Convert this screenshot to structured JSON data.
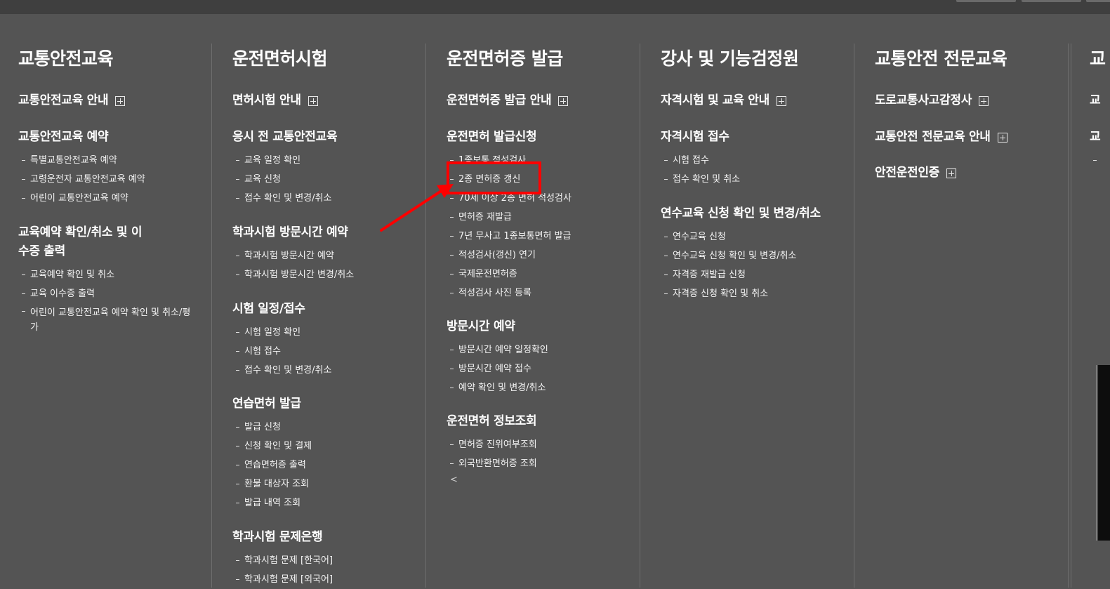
{
  "columns": [
    {
      "title": "교통안전교육",
      "sections": [
        {
          "label": "교통안전교육 안내",
          "expandable": true,
          "items": []
        },
        {
          "label": "교통안전교육 예약",
          "expandable": false,
          "items": [
            "특별교통안전교육 예약",
            "고령운전자 교통안전교육 예약",
            "어린이 교통안전교육 예약"
          ]
        },
        {
          "label": "교육예약 확인/취소 및 이수증 출력",
          "expandable": false,
          "items": [
            "교육예약 확인 및 취소",
            "교육 이수증 출력",
            "어린이 교통안전교육 예약 확인 및 취소/평가"
          ]
        }
      ]
    },
    {
      "title": "운전면허시험",
      "sections": [
        {
          "label": "면허시험 안내",
          "expandable": true,
          "items": []
        },
        {
          "label": "응시 전 교통안전교육",
          "expandable": false,
          "items": [
            "교육 일정 확인",
            "교육 신청",
            "접수 확인 및 변경/취소"
          ]
        },
        {
          "label": "학과시험 방문시간 예약",
          "expandable": false,
          "items": [
            "학과시험 방문시간 예약",
            "학과시험 방문시간 변경/취소"
          ]
        },
        {
          "label": "시험 일정/접수",
          "expandable": false,
          "items": [
            "시험 일정 확인",
            "시험 접수",
            "접수 확인 및 변경/취소"
          ]
        },
        {
          "label": "연습면허 발급",
          "expandable": false,
          "items": [
            "발급 신청",
            "신청 확인 및 결제",
            "연습면허증 출력",
            "환불 대상자 조회",
            "발급 내역 조회"
          ]
        },
        {
          "label": "학과시험 문제은행",
          "expandable": false,
          "items": [
            "학과시험 문제 [한국어]",
            "학과시험 문제 [외국어]"
          ]
        }
      ]
    },
    {
      "title": "운전면허증 발급",
      "sections": [
        {
          "label": "운전면허증 발급 안내",
          "expandable": true,
          "items": []
        },
        {
          "label": "운전면허 발급신청",
          "expandable": false,
          "items": [
            "1종보통 적성검사",
            "2종 면허증 갱신",
            "70세 이상 2종 면허 적성검사",
            "면허증 재발급",
            "7년 무사고 1종보통면허 발급",
            "적성검사(갱신) 연기",
            "국제운전면허증",
            "적성검사 사진 등록"
          ]
        },
        {
          "label": "방문시간 예약",
          "expandable": false,
          "items": [
            "방문시간 예약 일정확인",
            "방문시간 예약 접수",
            "예약 확인 및 변경/취소"
          ]
        },
        {
          "label": "운전면허 정보조회",
          "expandable": false,
          "items": [
            "면허증 진위여부조회",
            "외국반환면허증 조회"
          ]
        }
      ],
      "trailing_glyph": "<"
    },
    {
      "title": "강사 및 기능검정원",
      "sections": [
        {
          "label": "자격시험 및 교육 안내",
          "expandable": true,
          "items": []
        },
        {
          "label": "자격시험 접수",
          "expandable": false,
          "items": [
            "시험 접수",
            "접수 확인 및 취소"
          ]
        },
        {
          "label": "연수교육 신청 확인 및 변경/취소",
          "expandable": false,
          "items": [
            "연수교육 신청",
            "연수교육 신청 확인 및 변경/취소",
            "자격증 재발급 신청",
            "자격증 신청 확인 및 취소"
          ]
        }
      ]
    },
    {
      "title": "교통안전 전문교육",
      "sections": [
        {
          "label": "도로교통사고감정사",
          "expandable": true,
          "items": []
        },
        {
          "label": "교통안전 전문교육 안내",
          "expandable": true,
          "items": []
        },
        {
          "label": "안전운전인증",
          "expandable": true,
          "items": []
        }
      ]
    },
    {
      "title": "교",
      "sections": [
        {
          "label": "교",
          "expandable": false,
          "items": []
        },
        {
          "label": "교",
          "expandable": false,
          "items": [
            "",
            "",
            "",
            "",
            "",
            ""
          ]
        }
      ]
    }
  ],
  "annotation": {
    "highlighted_item": "2종 면허증 갱신",
    "box_color": "#ff0000",
    "arrow_color": "#ff0000"
  }
}
